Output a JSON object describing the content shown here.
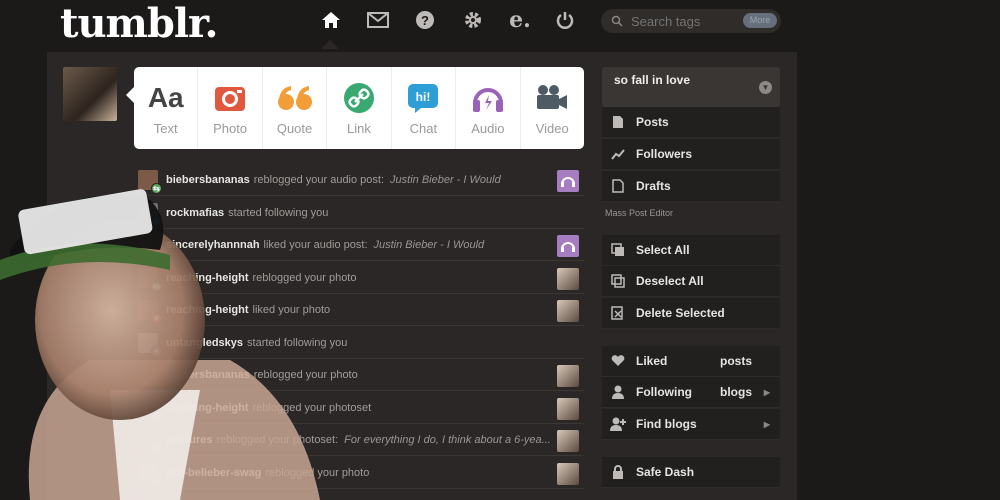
{
  "header": {
    "logo": "tumblr.",
    "nav_icons": [
      "home-icon",
      "mail-icon",
      "help-icon",
      "settings-icon",
      "edit-icon",
      "power-icon"
    ],
    "search": {
      "placeholder": "Search tags",
      "button": "More"
    }
  },
  "post_types": [
    {
      "label": "Text",
      "icon": "text-icon",
      "color": "#444444"
    },
    {
      "label": "Photo",
      "icon": "camera-icon",
      "color": "#e0583e"
    },
    {
      "label": "Quote",
      "icon": "quote-icon",
      "color": "#f29d38"
    },
    {
      "label": "Link",
      "icon": "link-icon",
      "color": "#3aa871"
    },
    {
      "label": "Chat",
      "icon": "chat-icon",
      "color": "#2e9fd6"
    },
    {
      "label": "Audio",
      "icon": "headphones-icon",
      "color": "#9a63b9"
    },
    {
      "label": "Video",
      "icon": "video-camera-icon",
      "color": "#4e5a64"
    }
  ],
  "activity": [
    {
      "user": "biebersbananas",
      "action": "reblogged your audio post:",
      "quote": "Justin Bieber - I Would",
      "badge": "reblog",
      "thumb": "audio"
    },
    {
      "user": "rockmafias",
      "action": "started following you",
      "quote": "",
      "badge": "follow",
      "thumb": ""
    },
    {
      "user": "sincerelyhannnah",
      "action": "liked your audio post:",
      "quote": "Justin Bieber - I Would",
      "badge": "like",
      "thumb": "audio"
    },
    {
      "user": "reaching-height",
      "action": "reblogged your photo",
      "quote": "",
      "badge": "reblog",
      "thumb": "photo"
    },
    {
      "user": "reaching-height",
      "action": "liked your photo",
      "quote": "",
      "badge": "like",
      "thumb": "photo"
    },
    {
      "user": "untangledskys",
      "action": "started following you",
      "quote": "",
      "badge": "follow",
      "thumb": ""
    },
    {
      "user": "biebersbananas",
      "action": "reblogged your photo",
      "quote": "",
      "badge": "reblog",
      "thumb": "photo"
    },
    {
      "user": "reaching-height",
      "action": "reblogged your photoset",
      "quote": "",
      "badge": "reblog",
      "thumb": "photo"
    },
    {
      "user": "p-ictures",
      "action": "reblogged your photoset:",
      "quote": "For everything I do, I think about a 6-yea...",
      "badge": "reblog",
      "thumb": "photo"
    },
    {
      "user": "javi-belieber-swag",
      "action": "reblogged your photo",
      "quote": "",
      "badge": "reblog",
      "thumb": "photo"
    }
  ],
  "sidebar": {
    "blog_title": "so fall in love",
    "nav": [
      {
        "label": "Posts",
        "icon": "document-icon"
      },
      {
        "label": "Followers",
        "icon": "chart-icon"
      },
      {
        "label": "Drafts",
        "icon": "draft-icon"
      }
    ],
    "mass_editor_caption": "Mass Post Editor",
    "editor": [
      {
        "label": "Select All",
        "icon": "select-all-icon"
      },
      {
        "label": "Deselect All",
        "icon": "deselect-icon"
      },
      {
        "label": "Delete Selected",
        "icon": "delete-icon"
      }
    ],
    "account": [
      {
        "label": "Liked",
        "extra": "posts",
        "icon": "heart-icon"
      },
      {
        "label": "Following",
        "extra": "blogs",
        "icon": "person-icon"
      },
      {
        "label": "Find blogs",
        "extra": "",
        "icon": "add-person-icon"
      }
    ],
    "safe_dash": "Safe Dash"
  },
  "colors": {
    "background": "#1c1a19",
    "panel": "#2a2726",
    "reblog": "#5aa85f",
    "follow": "#4f80b5",
    "like": "#d9534f"
  }
}
